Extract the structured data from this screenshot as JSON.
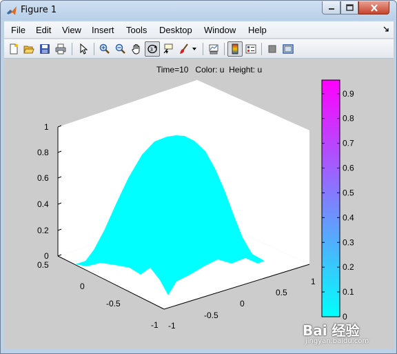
{
  "window": {
    "title": "Figure 1"
  },
  "menubar": {
    "items": [
      {
        "id": "file",
        "label": "File"
      },
      {
        "id": "edit",
        "label": "Edit"
      },
      {
        "id": "view",
        "label": "View"
      },
      {
        "id": "insert",
        "label": "Insert"
      },
      {
        "id": "tools",
        "label": "Tools"
      },
      {
        "id": "desktop",
        "label": "Desktop"
      },
      {
        "id": "window",
        "label": "Window"
      },
      {
        "id": "help",
        "label": "Help"
      }
    ]
  },
  "toolbar": {
    "icons": [
      "new-figure-icon",
      "open-file-icon",
      "save-icon",
      "print-icon",
      "edit-plot-arrow-icon",
      "zoom-in-icon",
      "zoom-out-icon",
      "pan-hand-icon",
      "rotate-3d-icon",
      "data-cursor-icon",
      "brush-icon",
      "brush-menu-arrow-icon",
      "link-plot-icon",
      "insert-colorbar-icon",
      "insert-legend-icon",
      "hide-plot-tools-icon",
      "show-plot-tools-icon"
    ]
  },
  "plot": {
    "title_line": "Time=10   Color: u  Height: u"
  },
  "chart_data": {
    "type": "surface",
    "title": "Time=10   Color: u  Height: u",
    "z_ticks": [
      "0",
      "0.2",
      "0.4",
      "0.6",
      "0.8",
      "1"
    ],
    "x_ticks": [
      "-1",
      "-0.5",
      "0",
      "0.5",
      "1"
    ],
    "y_ticks": [
      "-1",
      "-0.5",
      "0",
      "0.5"
    ],
    "zlim": [
      0,
      1
    ],
    "xlim": [
      -1,
      1
    ],
    "ylim": [
      -1,
      1
    ],
    "peak_value": 0.95,
    "colormap": {
      "low": "#00ffff",
      "high": "#ff00ff"
    },
    "colorbar": {
      "ticks": [
        "0",
        "0.1",
        "0.2",
        "0.3",
        "0.4",
        "0.5",
        "0.6",
        "0.7",
        "0.8",
        "0.9"
      ],
      "range": [
        0,
        0.955
      ]
    }
  },
  "watermark": {
    "logo": "Bai 经验",
    "url": "jingyan.baidu.com"
  }
}
